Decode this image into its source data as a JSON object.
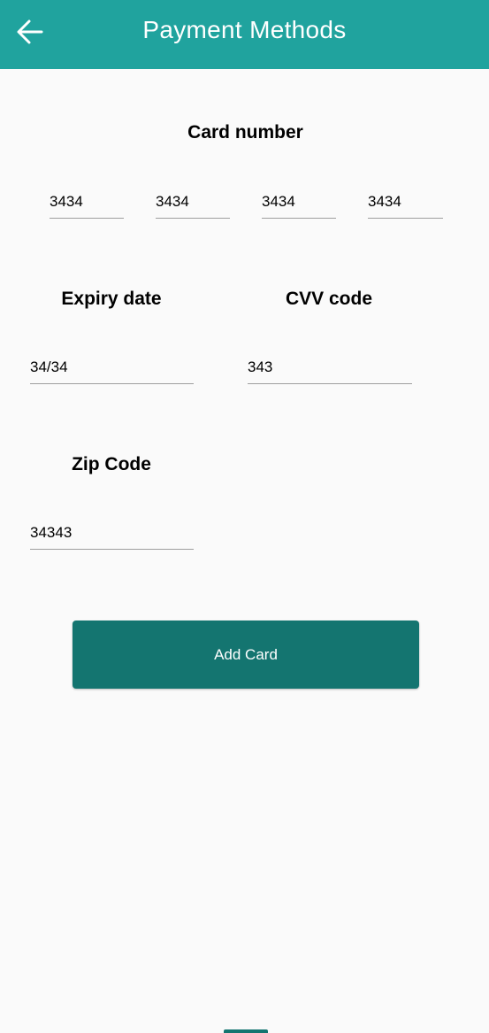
{
  "app_bar": {
    "title": "Payment Methods",
    "back_icon": "arrow-left-icon",
    "background_color": "#20a39e"
  },
  "card_number": {
    "label": "Card number",
    "groups": [
      "3434",
      "3434",
      "3434",
      "3434"
    ]
  },
  "expiry": {
    "label": "Expiry date",
    "value": "34/34"
  },
  "cvv": {
    "label": "CVV code",
    "value": "343"
  },
  "zip": {
    "label": "Zip Code",
    "value": "34343"
  },
  "add_card_button": {
    "label": "Add Card",
    "color": "#147570"
  }
}
